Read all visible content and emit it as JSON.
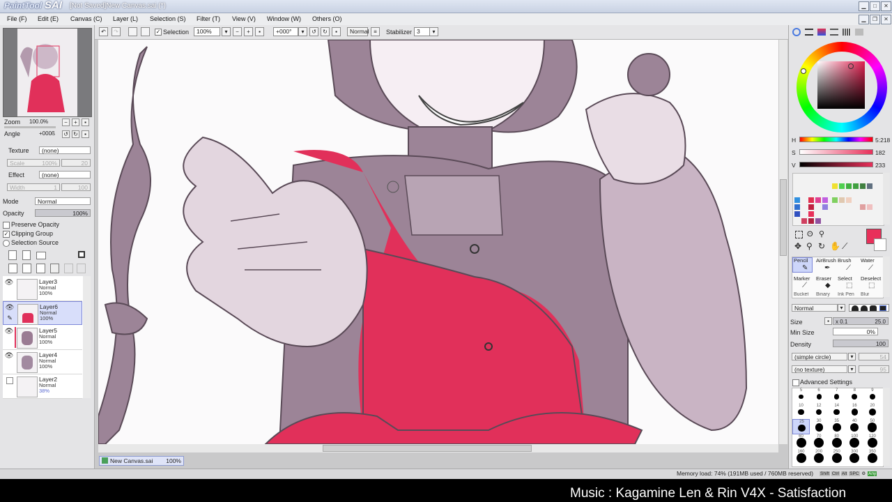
{
  "window": {
    "logo_small": "PaintTool",
    "logo_big": "SAI",
    "title": "[Not Saved]New Canvas.sai (*)"
  },
  "menu": [
    "File (F)",
    "Edit (E)",
    "Canvas (C)",
    "Layer (L)",
    "Selection (S)",
    "Filter (T)",
    "View (V)",
    "Window (W)",
    "Others (O)"
  ],
  "toolbar": {
    "selection_label": "Selection",
    "selection_checked": true,
    "zoom": "100%",
    "angle": "+000°",
    "blend": "Normal",
    "stabilizer_label": "Stabilizer",
    "stabilizer": "3"
  },
  "navigator": {
    "zoom_label": "Zoom",
    "zoom_value": "100.0%",
    "angle_label": "Angle",
    "angle_value": "+000ß"
  },
  "left": {
    "texture_label": "Texture",
    "texture_value": "(none)",
    "scale_label": "Scale",
    "scale_value": "100%",
    "scale_num": "20",
    "effect_label": "Effect",
    "effect_value": "(none)",
    "width_label": "Width",
    "width_num1": "1",
    "width_num2": "100",
    "mode_label": "Mode",
    "mode_value": "Normal",
    "opacity_label": "Opacity",
    "opacity_value": "100%",
    "preserve_opacity": "Preserve Opacity",
    "clipping_group": "Clipping Group",
    "selection_source": "Selection Source"
  },
  "layers": [
    {
      "name": "Layer3",
      "mode": "Normal",
      "opacity": "100%",
      "visible": true
    },
    {
      "name": "Layer6",
      "mode": "Normal",
      "opacity": "100%",
      "visible": true,
      "selected": true
    },
    {
      "name": "Layer5",
      "mode": "Normal",
      "opacity": "100%",
      "visible": true
    },
    {
      "name": "Layer4",
      "mode": "Normal",
      "opacity": "100%",
      "visible": true
    },
    {
      "name": "Layer2",
      "mode": "Normal",
      "opacity": "38%",
      "visible": false
    }
  ],
  "color": {
    "h_label": "H",
    "h_value": "5:218",
    "s_label": "S",
    "s_value": "182",
    "v_label": "V",
    "v_value": "233",
    "current": "#e8305a"
  },
  "tools": [
    [
      "Pencil",
      "AirBrush",
      "Brush",
      "Water"
    ],
    [
      "Marker",
      "Eraser",
      "Select",
      "Deselect"
    ],
    [
      "Bucket",
      "Binary",
      "Ink Pen",
      "Blur"
    ]
  ],
  "brush": {
    "mode": "Normal",
    "size_label": "Size",
    "size_mult": "x 0.1",
    "size_value": "25.0",
    "minsize_label": "Min Size",
    "minsize_value": "0%",
    "density_label": "Density",
    "density_value": "100",
    "shape": "(simple circle)",
    "shape_num": "54",
    "texture": "(no texture)",
    "texture_num": "95",
    "advanced": "Advanced Settings",
    "sizes": [
      "5",
      "6",
      "7",
      "8",
      "9",
      "10",
      "12",
      "14",
      "16",
      "20",
      "25",
      "30",
      "35",
      "40",
      "50",
      "60",
      "70",
      "80",
      "100",
      "120",
      "160",
      "200",
      "250",
      "300",
      "350"
    ],
    "selected_size": "25"
  },
  "tab": {
    "name": "New Canvas.sai",
    "zoom": "100%"
  },
  "status": {
    "memory": "Memory load: 74% (191MB used / 760MB reserved)",
    "keys": [
      "Shift",
      "Ctrl",
      "Alt",
      "SPC",
      "Any"
    ]
  },
  "caption": "Music : Kagamine Len & Rin V4X - Satisfaction"
}
